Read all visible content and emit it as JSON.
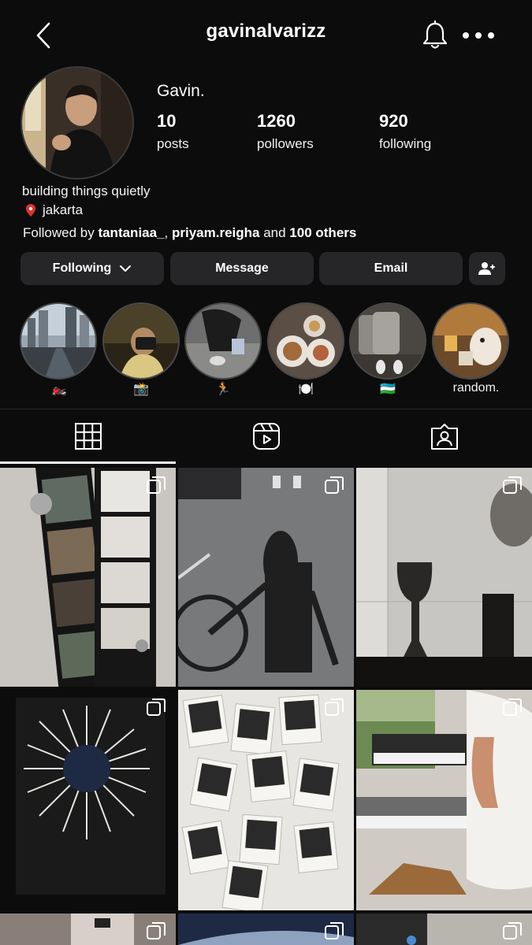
{
  "header": {
    "username": "gavinalvarizz",
    "icons": [
      "back-arrow-icon",
      "bell-icon",
      "more-icon"
    ]
  },
  "profile": {
    "display_name": "Gavin.",
    "stats": [
      {
        "value": "10",
        "label": "posts"
      },
      {
        "value": "1260",
        "label": "pollowers"
      },
      {
        "value": "920",
        "label": "following"
      }
    ],
    "bio": [
      "building things quietly",
      "jakarta"
    ],
    "location_icon": "pin-icon",
    "followed_by": {
      "prefix": "Followed by ",
      "users": [
        "tantaniaa_",
        "priyam.reigha"
      ],
      "separator": ", ",
      "and": " and ",
      "others": "100 others"
    }
  },
  "actions": {
    "following_label": "Following",
    "message_label": "Message",
    "email_label": "Email",
    "add_user_icon": "add-user-icon"
  },
  "highlights": [
    {
      "label": "🏍️",
      "icon": "motorcycle-emoji"
    },
    {
      "label": "📸",
      "icon": "camera-emoji"
    },
    {
      "label": "🏃",
      "icon": "runner-emoji"
    },
    {
      "label": "🍽️",
      "icon": "plate-emoji"
    },
    {
      "label": "🇺🇿",
      "icon": "flag-emoji"
    },
    {
      "label": "random.",
      "icon": ""
    }
  ],
  "tabs": [
    {
      "name": "posts",
      "icon": "grid-icon",
      "active": true
    },
    {
      "name": "reels",
      "icon": "reels-icon",
      "active": false
    },
    {
      "name": "tagged",
      "icon": "tagged-icon",
      "active": false
    }
  ],
  "colors": {
    "background": "#0c0c0d",
    "button": "#262628",
    "text": "#ffffff"
  }
}
